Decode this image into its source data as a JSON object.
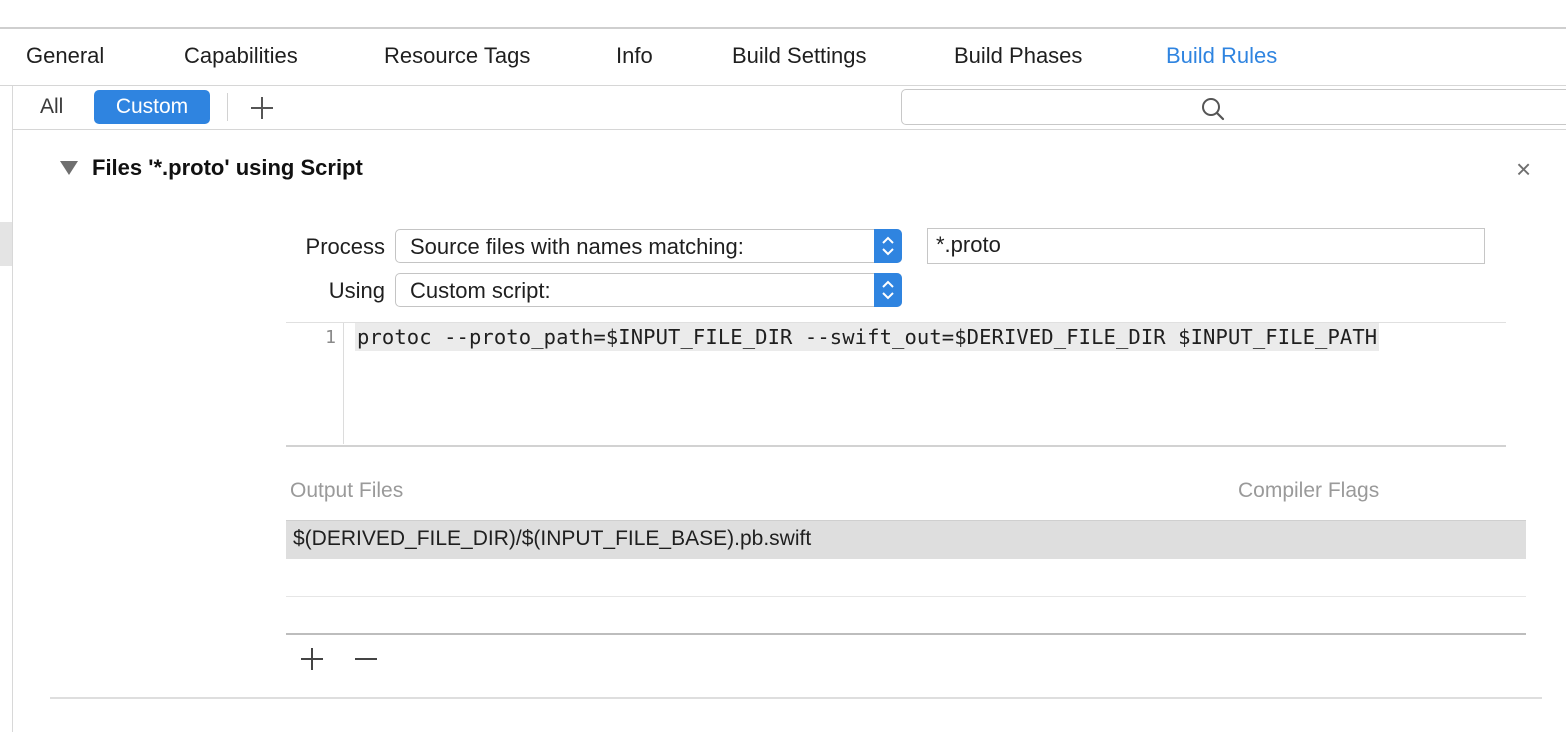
{
  "tabs": [
    {
      "label": "General"
    },
    {
      "label": "Capabilities"
    },
    {
      "label": "Resource Tags"
    },
    {
      "label": "Info"
    },
    {
      "label": "Build Settings"
    },
    {
      "label": "Build Phases"
    },
    {
      "label": "Build Rules",
      "active": true
    }
  ],
  "filter": {
    "all_label": "All",
    "custom_label": "Custom",
    "search_placeholder": ""
  },
  "rule": {
    "title": "Files '*.proto' using Script",
    "close_glyph": "×",
    "process_label": "Process",
    "process_value": "Source files with names matching:",
    "pattern_value": "*.proto",
    "using_label": "Using",
    "using_value": "Custom script:",
    "script": {
      "line_number": "1",
      "line_text": "protoc --proto_path=$INPUT_FILE_DIR --swift_out=$DERIVED_FILE_DIR $INPUT_FILE_PATH"
    },
    "output_files_header": "Output Files",
    "compiler_flags_header": "Compiler Flags",
    "output_files": [
      "$(DERIVED_FILE_DIR)/$(INPUT_FILE_BASE).pb.swift"
    ]
  },
  "colors": {
    "accent": "#2f84e0",
    "selected_row": "#dedede"
  },
  "icons": [
    "plus-icon",
    "search-icon",
    "disclosure-triangle-icon",
    "close-icon",
    "popup-stepper-icon",
    "minus-icon"
  ]
}
